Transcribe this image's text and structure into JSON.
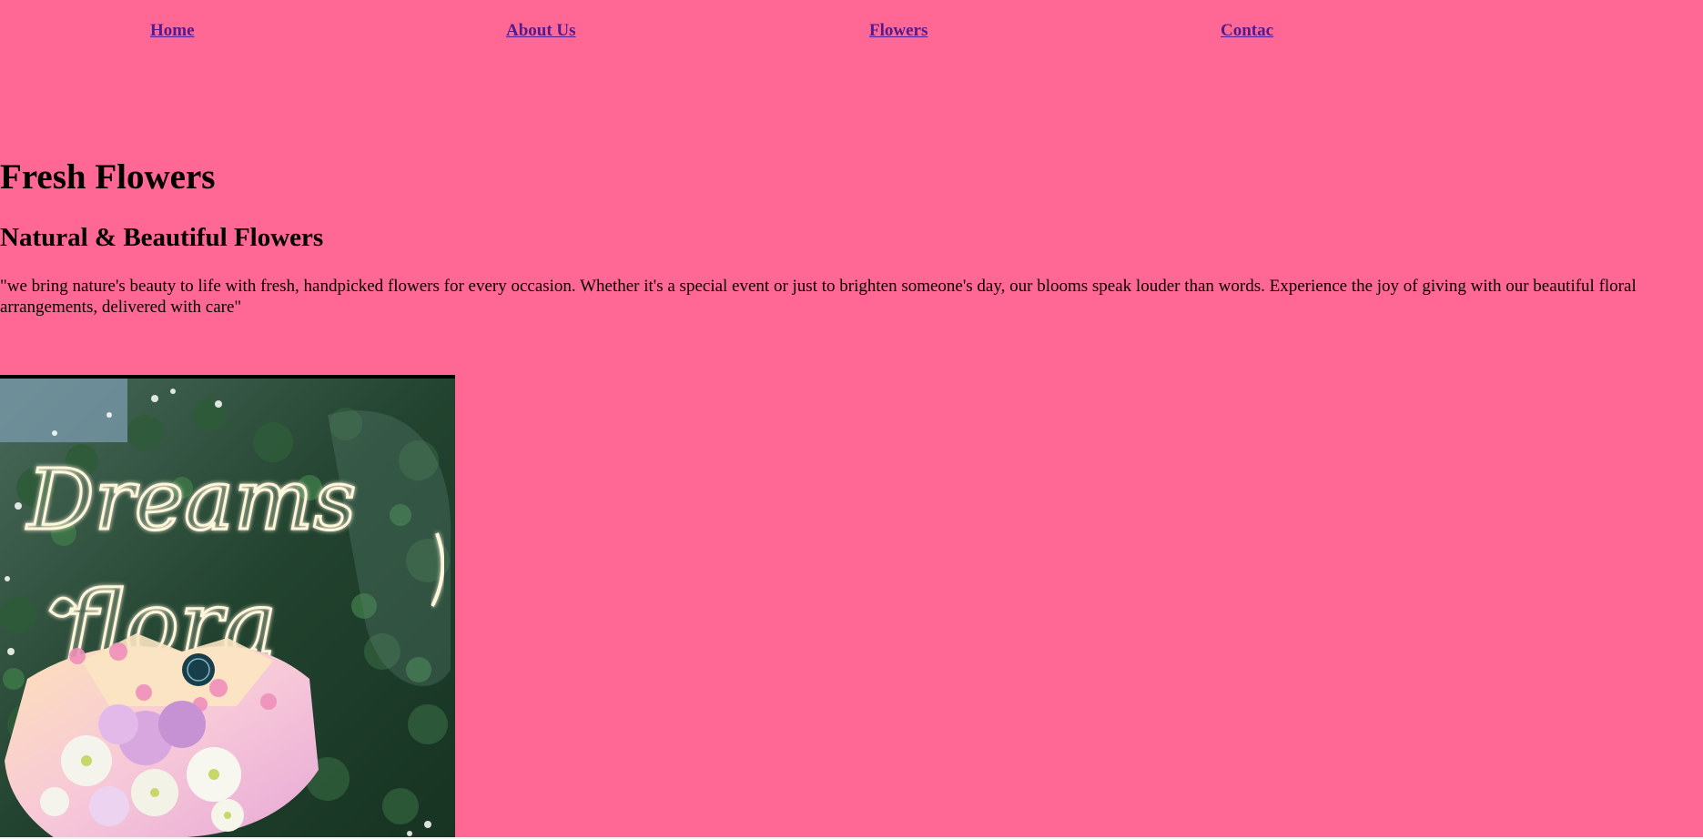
{
  "nav": {
    "items": [
      {
        "label": "Home"
      },
      {
        "label": "About Us"
      },
      {
        "label": "Flowers"
      },
      {
        "label": "Contac"
      }
    ]
  },
  "hero": {
    "title": "Fresh Flowers",
    "subtitle": "Natural & Beautiful Flowers",
    "description": "\"we bring nature's beauty to life with fresh, handpicked flowers for every occasion. Whether it's a special event or just to brighten someone's day, our blooms speak louder than words. Experience the joy of giving with our beautiful floral arrangements, delivered with care\""
  },
  "image": {
    "sign_line1": "Dreams",
    "sign_line2": "flora"
  },
  "colors": {
    "background": "#ff6795",
    "link": "#551a8b",
    "text": "#000000"
  }
}
